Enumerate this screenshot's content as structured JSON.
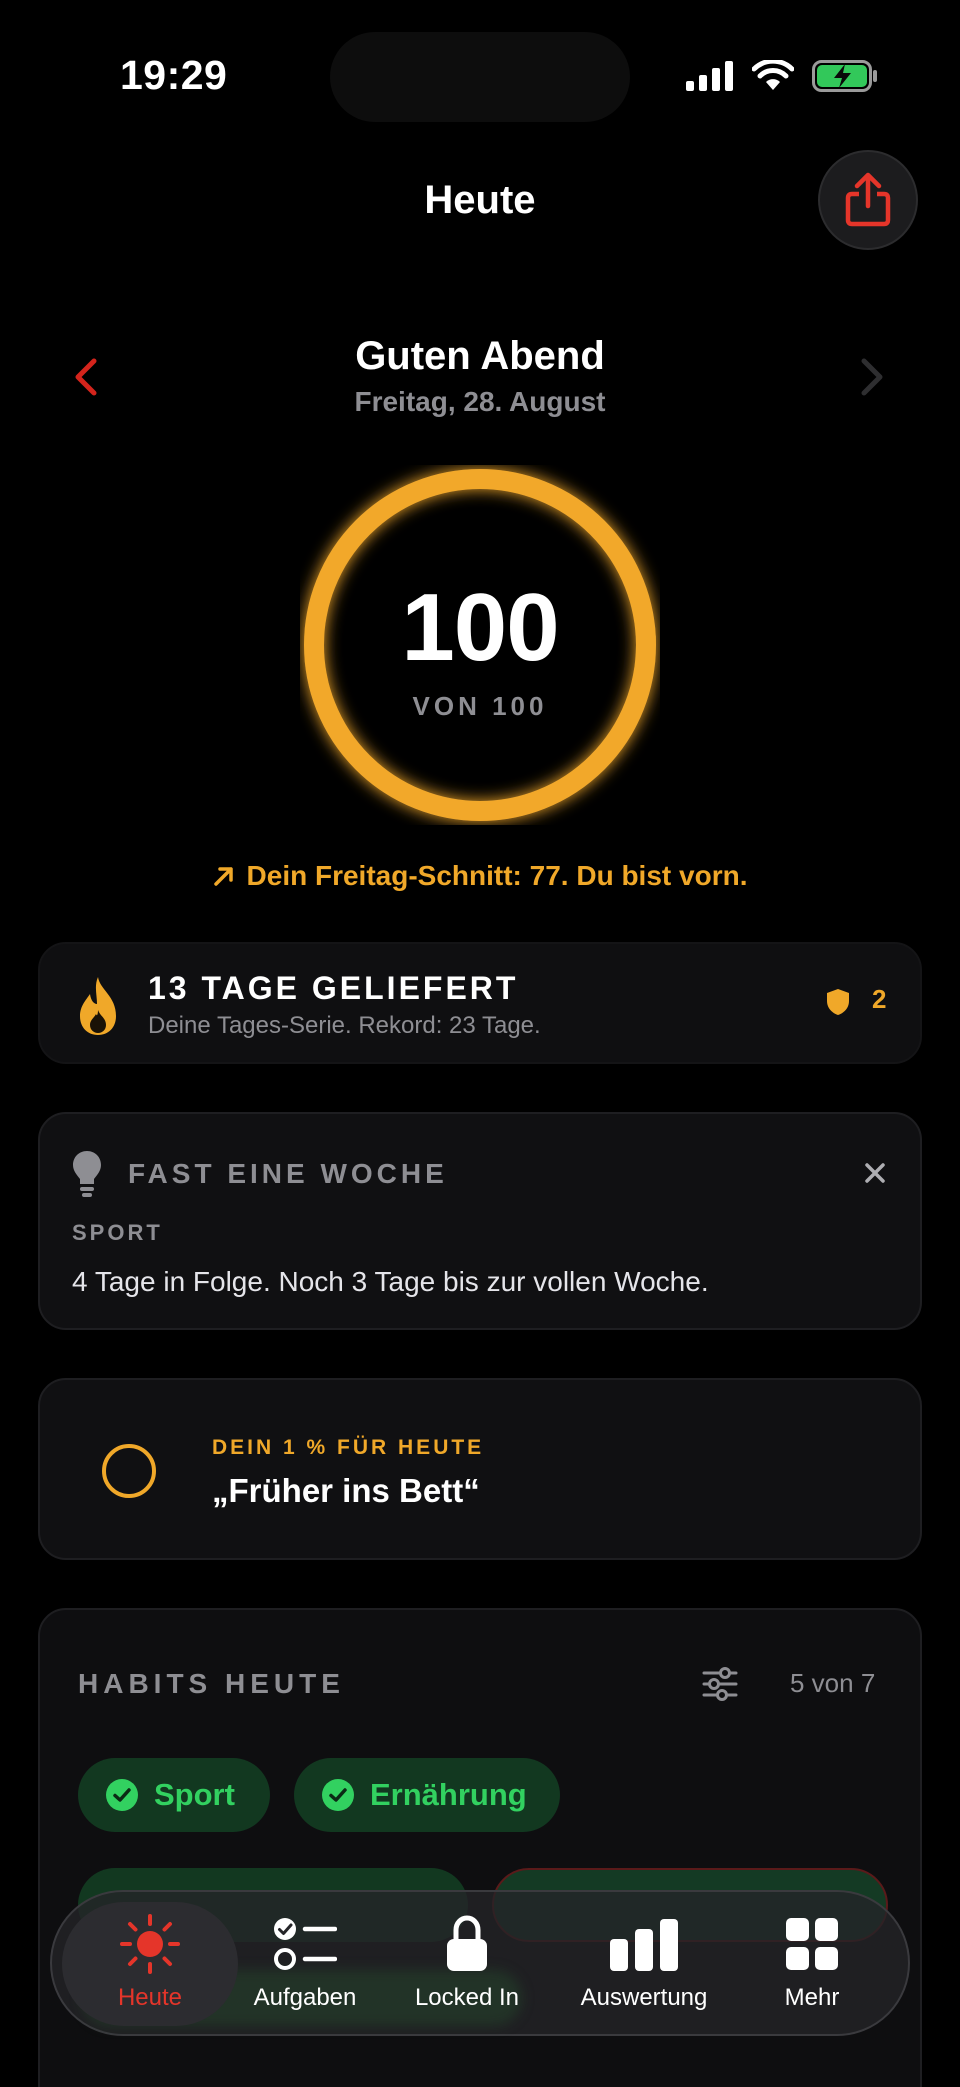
{
  "status_bar": {
    "time": "19:29"
  },
  "header": {
    "title": "Heute"
  },
  "greeting": {
    "title": "Guten Abend",
    "date": "Freitag, 28. August"
  },
  "score": {
    "value": "100",
    "max_label": "VON 100",
    "progress": 1.0
  },
  "comparison": {
    "text": "Dein Freitag-Schnitt: 77. Du bist vorn."
  },
  "streak": {
    "title": "13 TAGE GELIEFERT",
    "subtitle": "Deine Tages-Serie. Rekord: 23 Tage.",
    "freezes": "2"
  },
  "tip": {
    "title": "FAST EINE WOCHE",
    "label": "SPORT",
    "text": "4 Tage in Folge. Noch 3 Tage bis zur vollen Woche."
  },
  "focus": {
    "label": "DEIN 1 % FÜR HEUTE",
    "text": "„Früher ins Bett“"
  },
  "habits": {
    "title": "HABITS HEUTE",
    "count": "5 von 7",
    "items": [
      {
        "label": "Sport"
      },
      {
        "label": "Ernährung"
      }
    ]
  },
  "tab_bar": {
    "tabs": [
      {
        "label": "Heute"
      },
      {
        "label": "Aufgaben"
      },
      {
        "label": "Locked In"
      },
      {
        "label": "Auswertung"
      },
      {
        "label": "Mehr"
      }
    ]
  },
  "colors": {
    "accent_red": "#e5352a",
    "gold": "#f0a829",
    "success_green": "#32d160",
    "chip_green": "#123820",
    "background": "#000000"
  }
}
